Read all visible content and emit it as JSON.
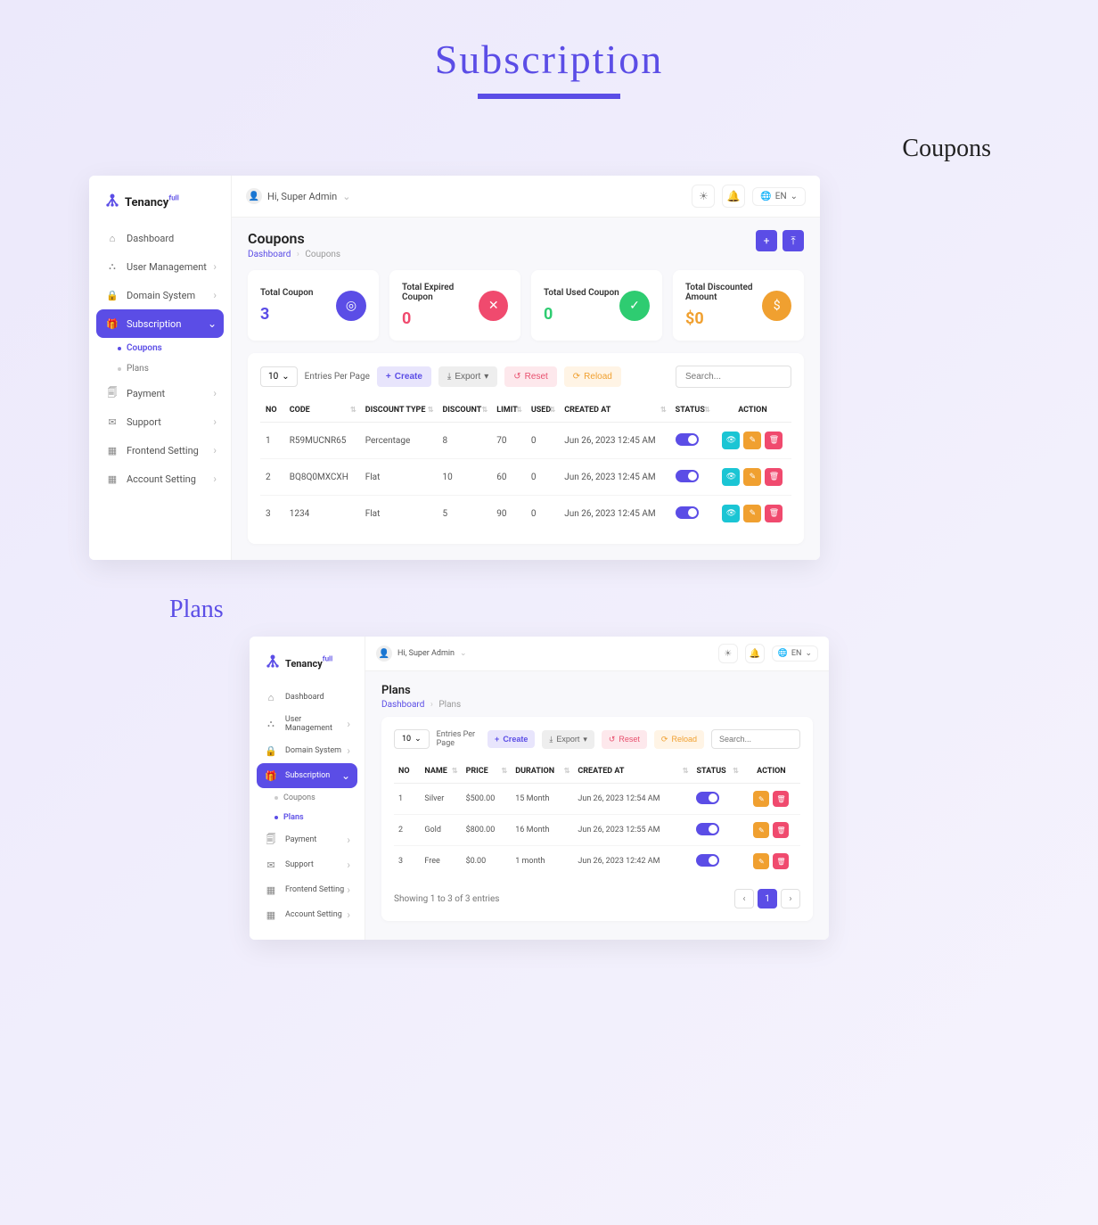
{
  "mainTitle": "Subscription",
  "sectionLabels": {
    "coupons": "Coupons",
    "plans": "Plans"
  },
  "brand": {
    "name": "Tenancy",
    "suffix": "full"
  },
  "topbar": {
    "greeting": "Hi, Super Admin",
    "lang": "EN"
  },
  "sidebar": {
    "items": [
      {
        "label": "Dashboard",
        "icon": "⌂"
      },
      {
        "label": "User Management",
        "icon": "⛬",
        "chevron": true
      },
      {
        "label": "Domain System",
        "icon": "🔒",
        "chevron": true
      },
      {
        "label": "Subscription",
        "icon": "🎁",
        "active": true,
        "chevron": true
      },
      {
        "label": "Payment",
        "icon": "🗐",
        "chevron": true
      },
      {
        "label": "Support",
        "icon": "✉",
        "chevron": true
      },
      {
        "label": "Frontend Setting",
        "icon": "▦",
        "chevron": true
      },
      {
        "label": "Account Setting",
        "icon": "▦",
        "chevron": true
      }
    ],
    "subCoupons": "Coupons",
    "subPlans": "Plans"
  },
  "couponsPage": {
    "title": "Coupons",
    "breadcrumb": {
      "root": "Dashboard",
      "current": "Coupons"
    },
    "stats": [
      {
        "label": "Total Coupon",
        "value": "3",
        "color": "#5b4de6",
        "valueColor": "#5b4de6",
        "icon": "◎"
      },
      {
        "label": "Total Expired Coupon",
        "value": "0",
        "color": "#f04a6e",
        "valueColor": "#f04a6e",
        "icon": "✕"
      },
      {
        "label": "Total Used Coupon",
        "value": "0",
        "color": "#2ecc71",
        "valueColor": "#2ecc71",
        "icon": "✓"
      },
      {
        "label": "Total Discounted Amount",
        "value": "$0",
        "color": "#f0a030",
        "valueColor": "#f0a030",
        "icon": "$"
      }
    ],
    "toolbar": {
      "entriesValue": "10",
      "entriesLabel": "Entries Per Page",
      "create": "Create",
      "export": "Export",
      "reset": "Reset",
      "reload": "Reload",
      "searchPlaceholder": "Search..."
    },
    "columns": [
      "NO",
      "CODE",
      "DISCOUNT TYPE",
      "DISCOUNT",
      "LIMIT",
      "USED",
      "CREATED AT",
      "STATUS",
      "ACTION"
    ],
    "rows": [
      {
        "no": "1",
        "code": "R59MUCNR65",
        "type": "Percentage",
        "discount": "8",
        "limit": "70",
        "used": "0",
        "created": "Jun 26, 2023 12:45 AM"
      },
      {
        "no": "2",
        "code": "BQ8Q0MXCXH",
        "type": "Flat",
        "discount": "10",
        "limit": "60",
        "used": "0",
        "created": "Jun 26, 2023 12:45 AM"
      },
      {
        "no": "3",
        "code": "1234",
        "type": "Flat",
        "discount": "5",
        "limit": "90",
        "used": "0",
        "created": "Jun 26, 2023 12:45 AM"
      }
    ]
  },
  "plansPage": {
    "title": "Plans",
    "breadcrumb": {
      "root": "Dashboard",
      "current": "Plans"
    },
    "toolbar": {
      "entriesValue": "10",
      "entriesLabel": "Entries Per Page",
      "create": "Create",
      "export": "Export",
      "reset": "Reset",
      "reload": "Reload",
      "searchPlaceholder": "Search..."
    },
    "columns": [
      "NO",
      "NAME",
      "PRICE",
      "DURATION",
      "CREATED AT",
      "STATUS",
      "ACTION"
    ],
    "rows": [
      {
        "no": "1",
        "name": "Silver",
        "price": "$500.00",
        "duration": "15 Month",
        "created": "Jun 26, 2023 12:54 AM"
      },
      {
        "no": "2",
        "name": "Gold",
        "price": "$800.00",
        "duration": "16 Month",
        "created": "Jun 26, 2023 12:55 AM"
      },
      {
        "no": "3",
        "name": "Free",
        "price": "$0.00",
        "duration": "1 month",
        "created": "Jun 26, 2023 12:42 AM"
      }
    ],
    "footer": {
      "showing": "Showing 1 to 3 of 3 entries",
      "page": "1"
    }
  }
}
